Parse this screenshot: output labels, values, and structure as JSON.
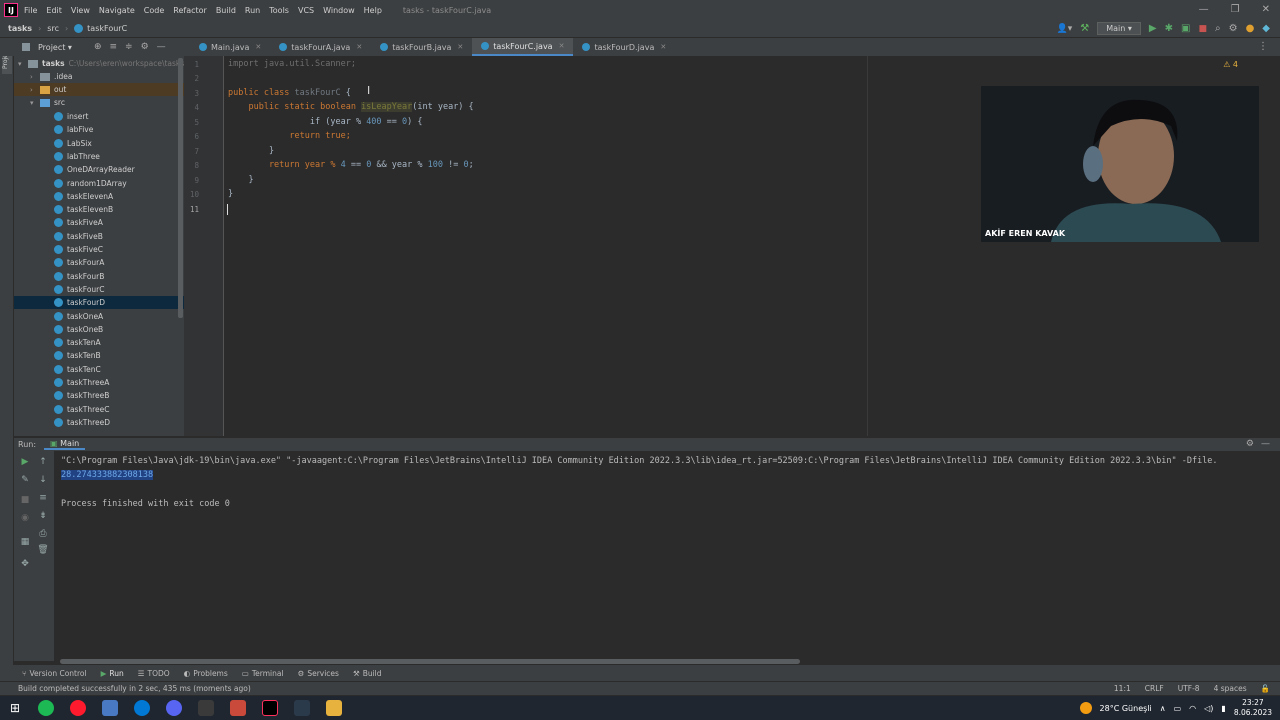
{
  "menubar": {
    "items": [
      "File",
      "Edit",
      "View",
      "Navigate",
      "Code",
      "Refactor",
      "Build",
      "Run",
      "Tools",
      "VCS",
      "Window",
      "Help"
    ],
    "title": "tasks - taskFourC.java"
  },
  "navbar": {
    "project": "tasks",
    "folder": "src",
    "file": "taskFourC",
    "run_config": "Main"
  },
  "project_panel": {
    "label": "Project",
    "root": "tasks",
    "root_path": "C:\\Users\\eren\\workspace\\tasks",
    "folders": [
      ".idea",
      "out",
      "src"
    ],
    "classes": [
      "insert",
      "labFive",
      "LabSix",
      "labThree",
      "OneDArrayReader",
      "random1DArray",
      "taskElevenA",
      "taskElevenB",
      "taskFiveA",
      "taskFiveB",
      "taskFiveC",
      "taskFourA",
      "taskFourB",
      "taskFourC",
      "taskFourD",
      "taskOneA",
      "taskOneB",
      "taskTenA",
      "taskTenB",
      "taskTenC",
      "taskThreeA",
      "taskThreeB",
      "taskThreeC",
      "taskThreeD"
    ]
  },
  "tabs": [
    "Main.java",
    "taskFourA.java",
    "taskFourB.java",
    "taskFourC.java",
    "taskFourD.java"
  ],
  "editor": {
    "line_numbers": [
      "1",
      "2",
      "3",
      "4",
      "5",
      "6",
      "7",
      "8",
      "9",
      "10",
      "11"
    ],
    "warnings": "4",
    "code": {
      "l1": "import java.util.Scanner;",
      "l3a": "public class ",
      "l3b": "taskFourC",
      "l3c": " {",
      "l4a": "    public static boolean ",
      "l4b": "isLeapYear",
      "l4c": "(int year) {",
      "l5a": "        if (year % ",
      "l5b": "400",
      "l5c": " == ",
      "l5d": "0",
      "l5e": ") {",
      "l6": "            return true;",
      "l7": "        }",
      "l8a": "        return year % ",
      "l8b": "4",
      "l8c": " == ",
      "l8d": "0",
      "l8e": " && year % ",
      "l8f": "100",
      "l8g": " != ",
      "l8h": "0",
      "l8i": ";",
      "l9": "    }",
      "l10": "}"
    }
  },
  "webcam": {
    "name": "AKİF EREN KAVAK"
  },
  "run_panel": {
    "label": "Run:",
    "tab": "Main",
    "lines": [
      "\"C:\\Program Files\\Java\\jdk-19\\bin\\java.exe\" \"-javaagent:C:\\Program Files\\JetBrains\\IntelliJ IDEA Community Edition 2022.3.3\\lib\\idea_rt.jar=52509:C:\\Program Files\\JetBrains\\IntelliJ IDEA Community Edition 2022.3.3\\bin\" -Dfile.",
      "28.274333882308138",
      "",
      "Process finished with exit code 0"
    ]
  },
  "bottom_tabs": [
    "Version Control",
    "Run",
    "TODO",
    "Problems",
    "Terminal",
    "Services",
    "Build"
  ],
  "status": {
    "message": "Build completed successfully in 2 sec, 435 ms (moments ago)",
    "position": "11:1",
    "line_sep": "CRLF",
    "encoding": "UTF-8",
    "indent": "4 spaces"
  },
  "taskbar": {
    "weather": "28°C Güneşli",
    "time": "23:27",
    "date": "8.06.2023"
  },
  "colors": {
    "accent": "#4a88c7",
    "keyword": "#cc7832",
    "number": "#6897bb",
    "class_icon": "#3592c4"
  }
}
